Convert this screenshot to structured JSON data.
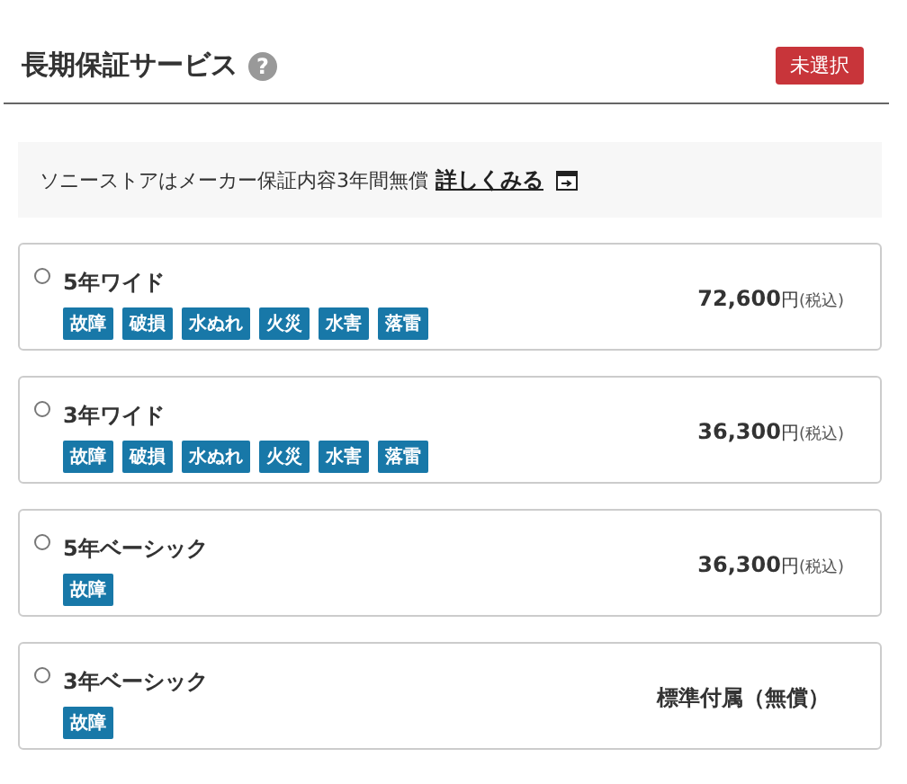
{
  "header": {
    "title": "長期保証サービス",
    "help_icon": "?",
    "status_badge": "未選択"
  },
  "info": {
    "text": "ソニーストアはメーカー保証内容3年間無償",
    "link": "詳しくみる"
  },
  "plans": [
    {
      "name": "5年ワイド",
      "selected": false,
      "tags": [
        "故障",
        "破損",
        "水ぬれ",
        "火災",
        "水害",
        "落雷"
      ],
      "kind": "price",
      "amount": "72,600",
      "unit": "円",
      "tax": "(税込)"
    },
    {
      "name": "3年ワイド",
      "selected": false,
      "tags": [
        "故障",
        "破損",
        "水ぬれ",
        "火災",
        "水害",
        "落雷"
      ],
      "kind": "price",
      "amount": "36,300",
      "unit": "円",
      "tax": "(税込)"
    },
    {
      "name": "5年ベーシック",
      "selected": false,
      "tags": [
        "故障"
      ],
      "kind": "price",
      "amount": "36,300",
      "unit": "円",
      "tax": "(税込)"
    },
    {
      "name": "3年ベーシック",
      "selected": false,
      "tags": [
        "故障"
      ],
      "kind": "note",
      "note": "標準付属（無償）"
    }
  ]
}
